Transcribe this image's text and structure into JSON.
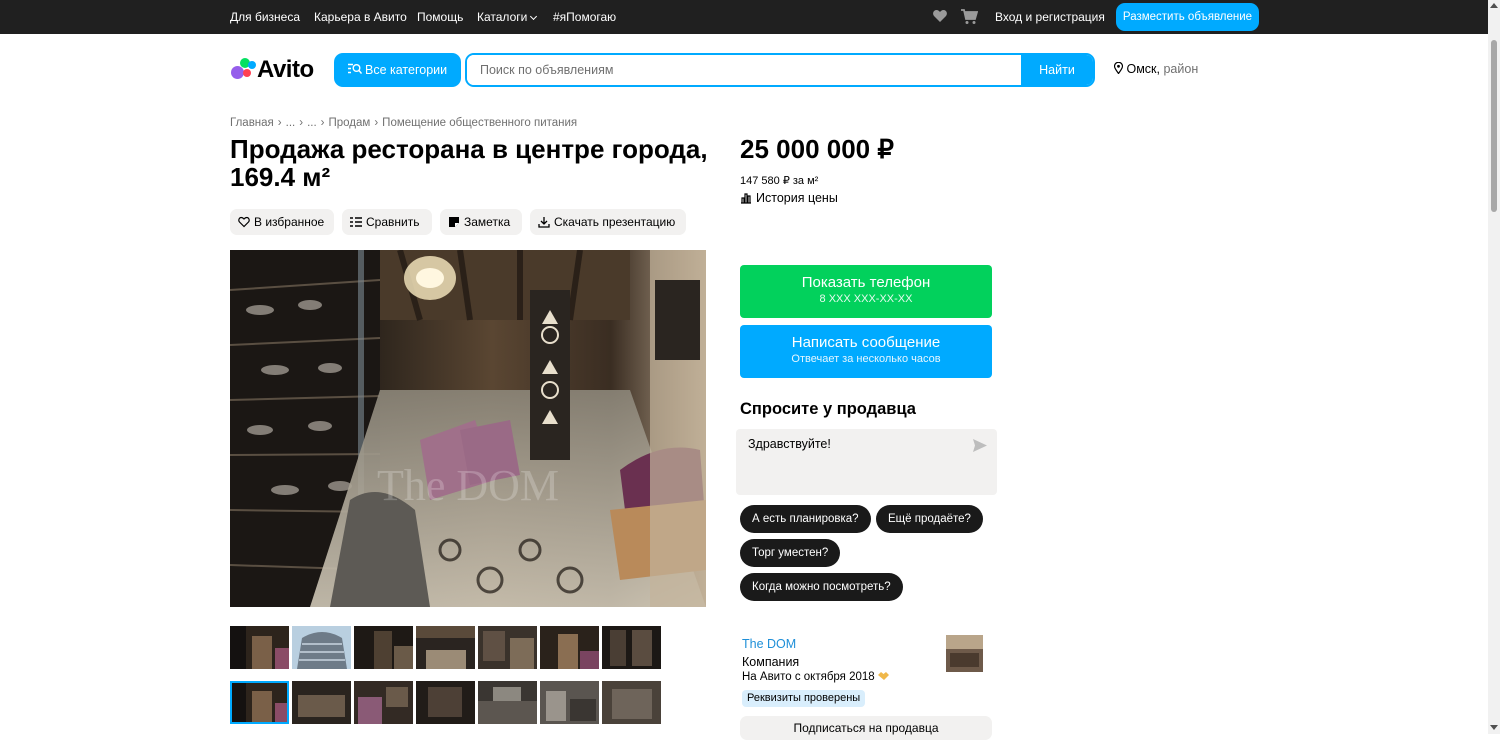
{
  "topbar": {
    "business": "Для бизнеса",
    "career": "Карьера в Авито",
    "help": "Помощь",
    "catalogs": "Каталоги",
    "tag": "#яПомогаю",
    "login": "Вход и регистрация",
    "post_ad": "Разместить объявление"
  },
  "header": {
    "logo_text": "Avito",
    "all_categories": "Все категории",
    "search_placeholder": "Поиск по объявлениям",
    "search_value": "",
    "find": "Найти",
    "city": "Омск,",
    "district": "район"
  },
  "breadcrumbs": [
    "Главная",
    "...",
    "...",
    "Продам",
    "Помещение общественного питания"
  ],
  "listing": {
    "title_line1": "Продажа ресторана в центре города,",
    "title_line2": "169.4 м²",
    "actions": {
      "favorite": "В избранное",
      "compare": "Сравнить",
      "note": "Заметка",
      "download": "Скачать презентацию"
    },
    "photo_watermark": "The DOM",
    "thumbnail_count": 14,
    "active_thumbnail": 7
  },
  "sidebar": {
    "price": "25 000 000 ₽",
    "price_per_m2": "147 580 ₽ за м²",
    "price_history": "История цены",
    "show_phone": "Показать телефон",
    "phone_mask": "8 XXX XXX-XX-XX",
    "write_message": "Написать сообщение",
    "response_time": "Отвечает за несколько часов",
    "ask_heading": "Спросите у продавца",
    "ask_text": "Здравствуйте!",
    "quick_questions": [
      "А есть планировка?",
      "Ещё продаёте?",
      "Торг уместен?",
      "Когда можно посмотреть?"
    ],
    "seller_name": "The DOM",
    "seller_type": "Компания",
    "seller_since": "На Авито с октября 2018",
    "seller_badge": "Реквизиты проверены",
    "subscribe": "Подписаться на продавца"
  },
  "colors": {
    "accent": "#00aaff",
    "green": "#02d15c",
    "topbar": "#202020",
    "link": "#1e8fd8"
  },
  "icons": [
    "heart-icon",
    "cart-icon",
    "search-icon",
    "location-pin-icon",
    "compare-icon",
    "note-icon",
    "download-icon",
    "chart-icon",
    "send-icon"
  ]
}
